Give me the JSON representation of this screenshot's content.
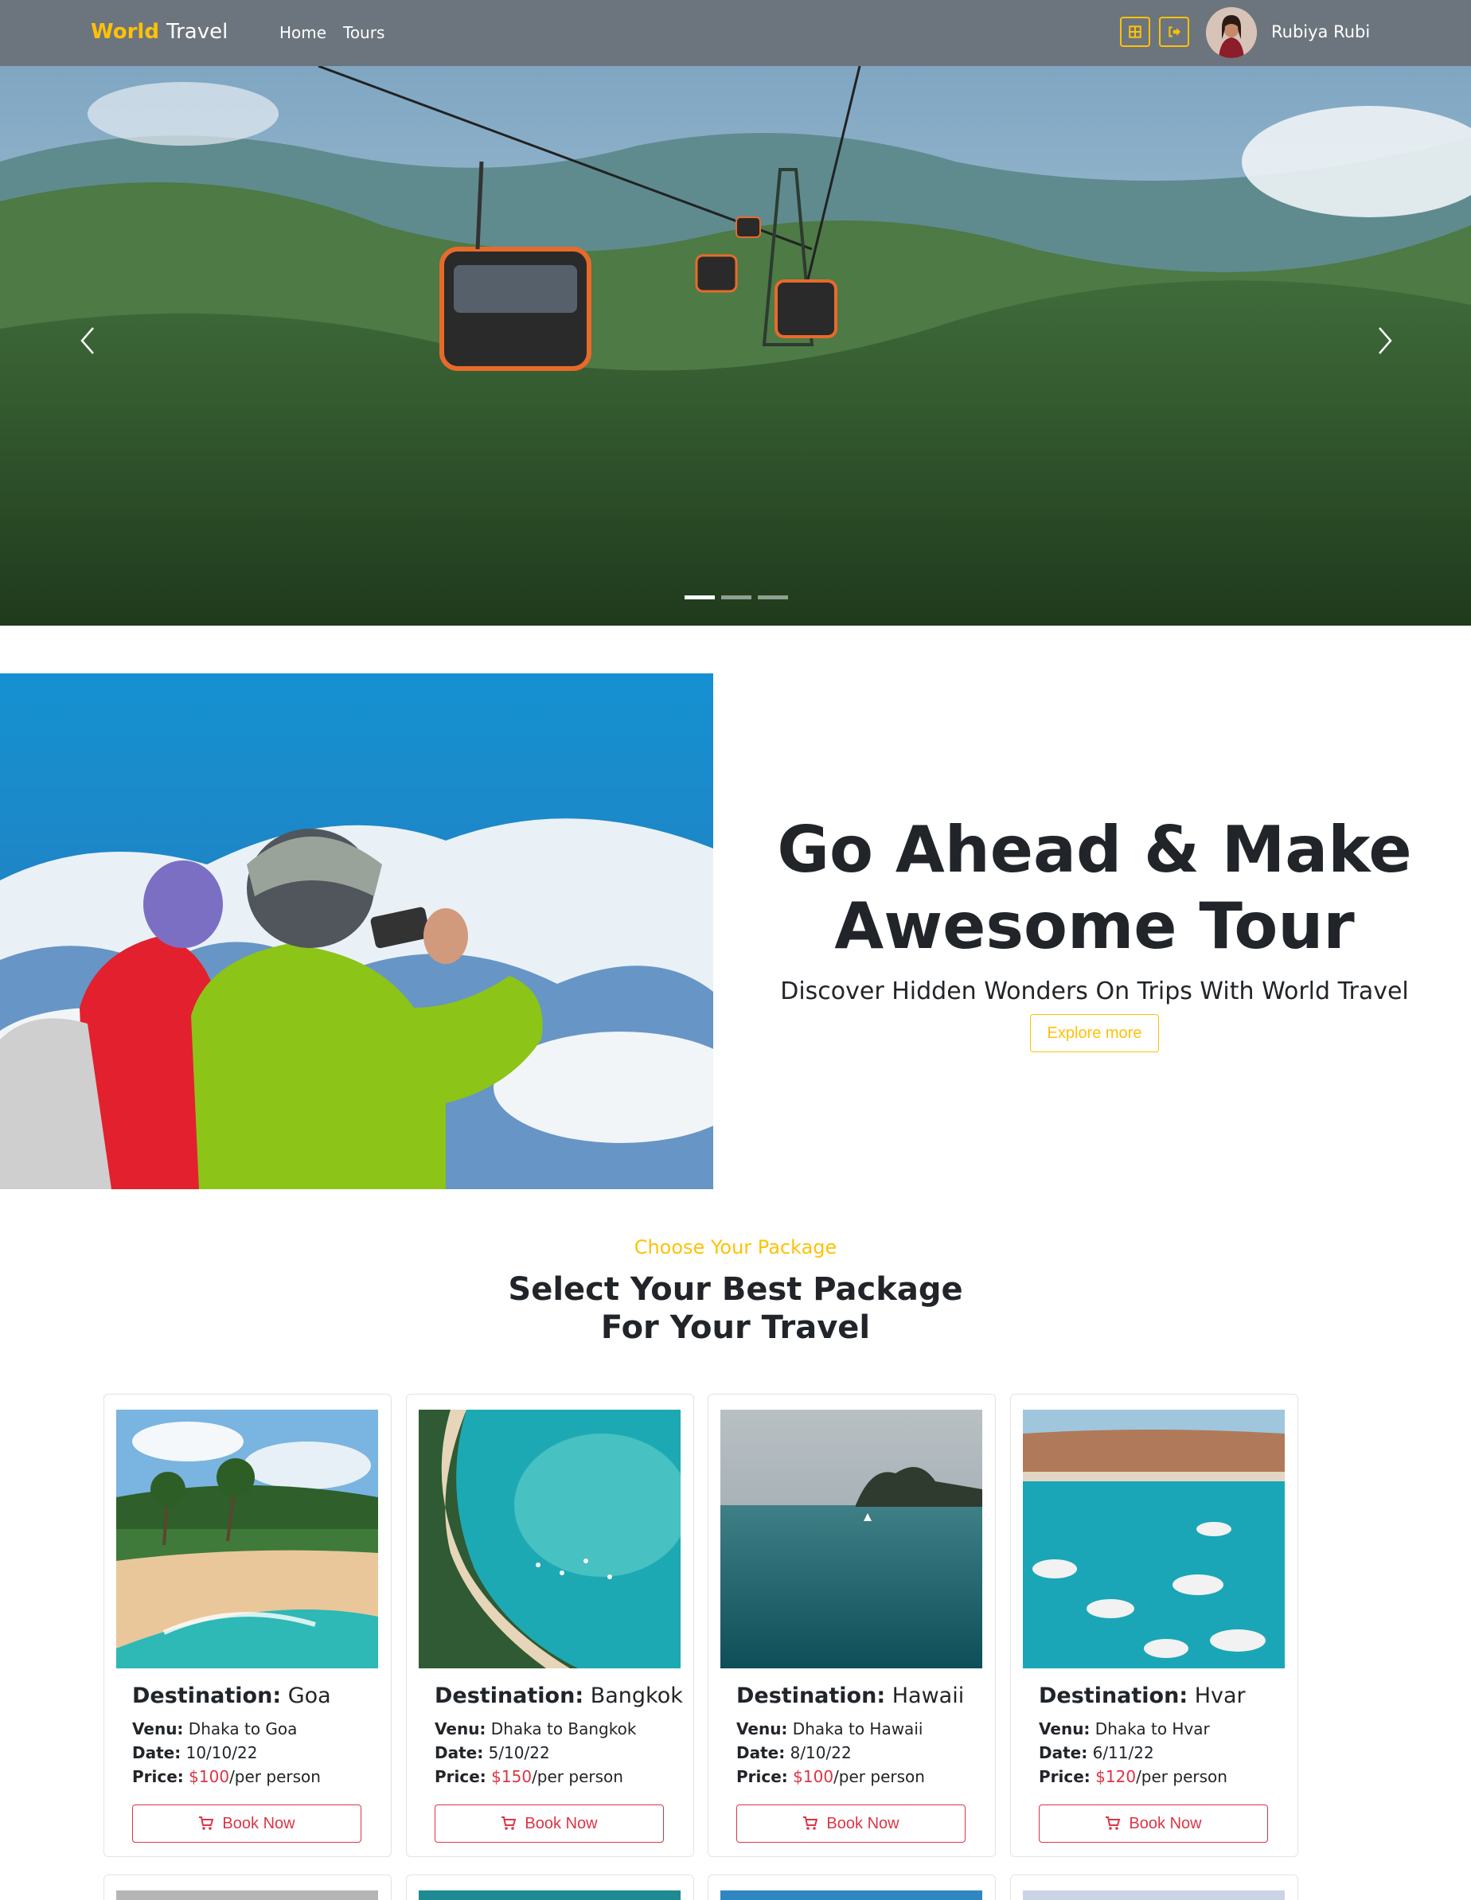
{
  "navbar": {
    "brand_highlight": "World",
    "brand_rest": "Travel",
    "links": [
      "Home",
      "Tours"
    ],
    "icons": [
      "dashboard-icon",
      "logout-icon"
    ],
    "user_name": "Rubiya Rubi"
  },
  "hero": {
    "slides_count": 3,
    "active_slide": 1
  },
  "about": {
    "title": "Go Ahead & Make Awesome Tour",
    "subtitle": "Discover Hidden Wonders On Trips With World Travel",
    "button_label": "Explore more"
  },
  "packages": {
    "kicker": "Choose Your Package",
    "title_line1": "Select Your Best Package",
    "title_line2": "For Your Travel",
    "labels": {
      "destination": "Destination:",
      "venu": "Venu:",
      "date": "Date:",
      "price": "Price:",
      "per": "/per person",
      "book": "Book Now"
    },
    "items": [
      {
        "destination": "Goa",
        "venu": "Dhaka to Goa",
        "date": "10/10/22",
        "price": "$100"
      },
      {
        "destination": "Bangkok",
        "venu": "Dhaka to Bangkok",
        "date": "5/10/22",
        "price": "$150"
      },
      {
        "destination": "Hawaii",
        "venu": "Dhaka to Hawaii",
        "date": "8/10/22",
        "price": "$100"
      },
      {
        "destination": "Hvar",
        "venu": "Dhaka to Hvar",
        "date": "6/11/22",
        "price": "$120"
      }
    ]
  },
  "colors": {
    "navbar_bg": "#6c757d",
    "accent_yellow": "#ffc107",
    "danger_red": "#dc3545",
    "text_dark": "#212529"
  }
}
